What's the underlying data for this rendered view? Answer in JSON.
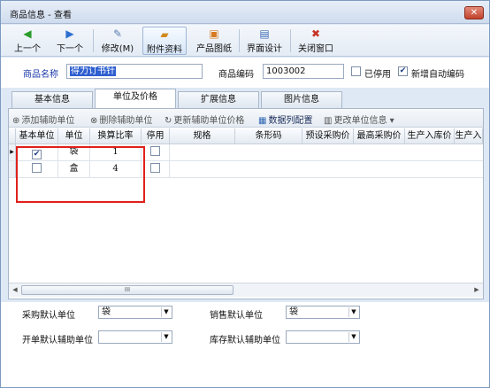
{
  "window": {
    "title": "商品信息 - 查看",
    "close_label": "✕"
  },
  "toolbar": {
    "prev": "上一个",
    "next": "下一个",
    "edit": "修改(M)",
    "attach": "附件资料",
    "drawing": "产品图纸",
    "ui_design": "界面设计",
    "close_window": "关闭窗口"
  },
  "form": {
    "name_label": "商品名称",
    "name_value": "得力订书针",
    "code_label": "商品编码",
    "code_value": "1003002",
    "disabled_label": "已停用",
    "disabled_checked": false,
    "autocode_label": "新增自动编码",
    "autocode_checked": true
  },
  "tabs": [
    "基本信息",
    "单位及价格",
    "扩展信息",
    "图片信息"
  ],
  "active_tab": "单位及价格",
  "subtoolbar": {
    "add_unit": "添加辅助单位",
    "delete_unit": "删除辅助单位",
    "update_price": "更新辅助单位价格",
    "column_config": "数据列配置",
    "change_unit": "更改单位信息"
  },
  "grid": {
    "columns": [
      "基本单位",
      "单位",
      "换算比率",
      "停用",
      "规格",
      "条形码",
      "预设采购价",
      "最高采购价",
      "生产入库价",
      "生产入"
    ],
    "rows": [
      {
        "base": true,
        "unit": "袋",
        "ratio": "1",
        "disabled": false
      },
      {
        "base": false,
        "unit": "盒",
        "ratio": "4",
        "disabled": false
      }
    ],
    "scroll_label": "III"
  },
  "bottom": {
    "purchase_label": "采购默认单位",
    "purchase_value": "袋",
    "sales_label": "销售默认单位",
    "sales_value": "袋",
    "billing_label": "开单默认辅助单位",
    "billing_value": "",
    "stock_label": "库存默认辅助单位",
    "stock_value": ""
  },
  "colors": {
    "highlight": "#e0201a",
    "link": "#1a39a8",
    "accent": "#dfe9f5"
  }
}
